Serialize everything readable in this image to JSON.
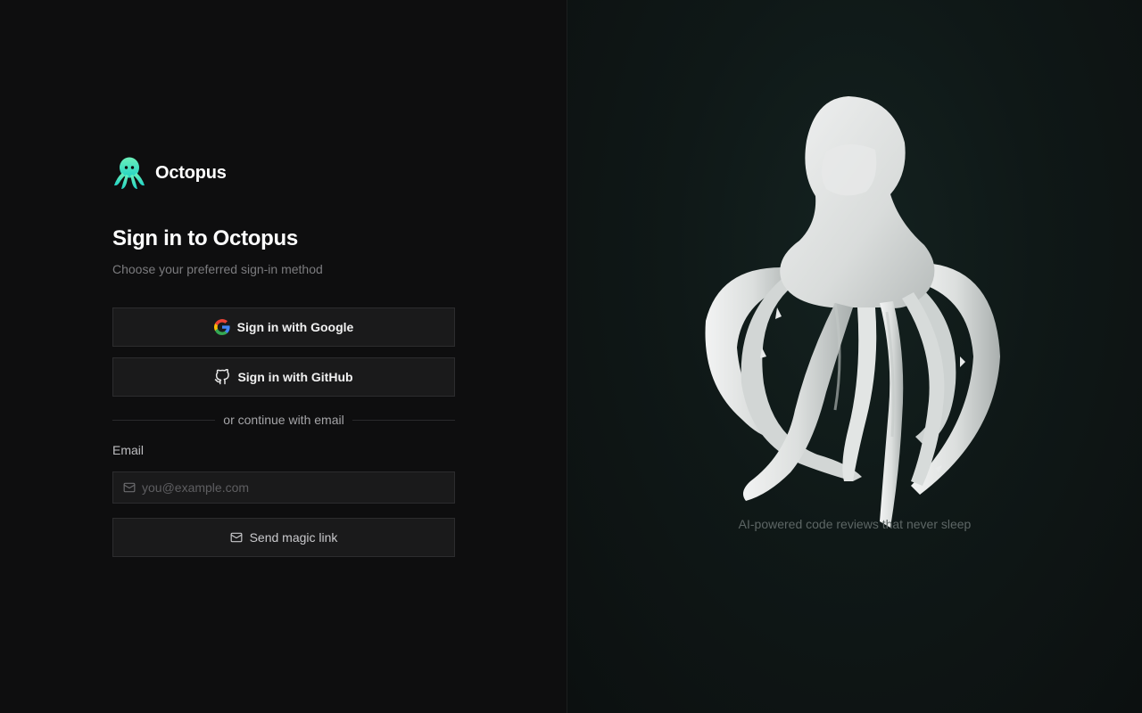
{
  "brand": {
    "name": "Octopus",
    "logo_icon": "octopus-logo-icon",
    "accent_color": "#3de3c4"
  },
  "signin": {
    "title": "Sign in to Octopus",
    "subtitle": "Choose your preferred sign-in method",
    "google_label": "Sign in with Google",
    "github_label": "Sign in with GitHub",
    "divider_text": "or continue with email",
    "email_label": "Email",
    "email_placeholder": "you@example.com",
    "email_value": "",
    "magic_link_label": "Send magic link"
  },
  "hero": {
    "tagline": "AI-powered code reviews that never sleep",
    "illustration": "octopus-3d-illustration"
  }
}
